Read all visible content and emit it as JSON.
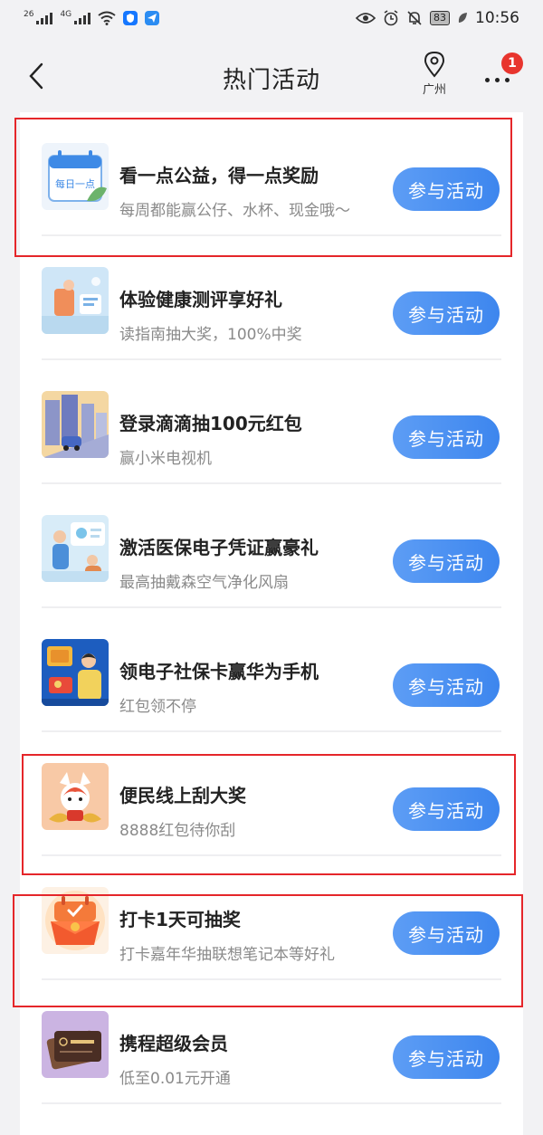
{
  "status_bar": {
    "signal1": "26",
    "signal2": "4G",
    "battery": "83",
    "time": "10:56"
  },
  "nav": {
    "title": "热门活动",
    "location": "广州",
    "badge_count": "1"
  },
  "activities": [
    {
      "title": "看一点公益，得一点奖励",
      "subtitle": "每周都能赢公仔、水杯、现金哦～",
      "button": "参与活动",
      "thumb_text": "每日一点",
      "icon": "daily-calendar-icon"
    },
    {
      "title": "体验健康测评享好礼",
      "subtitle": "读指南抽大奖，100%中奖",
      "button": "参与活动",
      "icon": "health-check-icon"
    },
    {
      "title": "登录滴滴抽100元红包",
      "subtitle": "赢小米电视机",
      "button": "参与活动",
      "icon": "didi-city-icon"
    },
    {
      "title": "激活医保电子凭证赢豪礼",
      "subtitle": "最高抽戴森空气净化风扇",
      "button": "参与活动",
      "icon": "medical-insurance-icon"
    },
    {
      "title": "领电子社保卡赢华为手机",
      "subtitle": "红包领不停",
      "button": "参与活动",
      "icon": "social-security-card-icon"
    },
    {
      "title": "便民线上刮大奖",
      "subtitle": "8888红包待你刮",
      "button": "参与活动",
      "icon": "scratch-card-icon"
    },
    {
      "title": "打卡1天可抽奖",
      "subtitle": "打卡嘉年华抽联想笔记本等好礼",
      "button": "参与活动",
      "icon": "checkin-calendar-icon"
    },
    {
      "title": "携程超级会员",
      "subtitle": "低至0.01元开通",
      "button": "参与活动",
      "icon": "ctrip-member-card-icon"
    }
  ],
  "colors": {
    "button": "#4a90ef",
    "highlight": "#e5262a",
    "badge": "#e8352e"
  }
}
